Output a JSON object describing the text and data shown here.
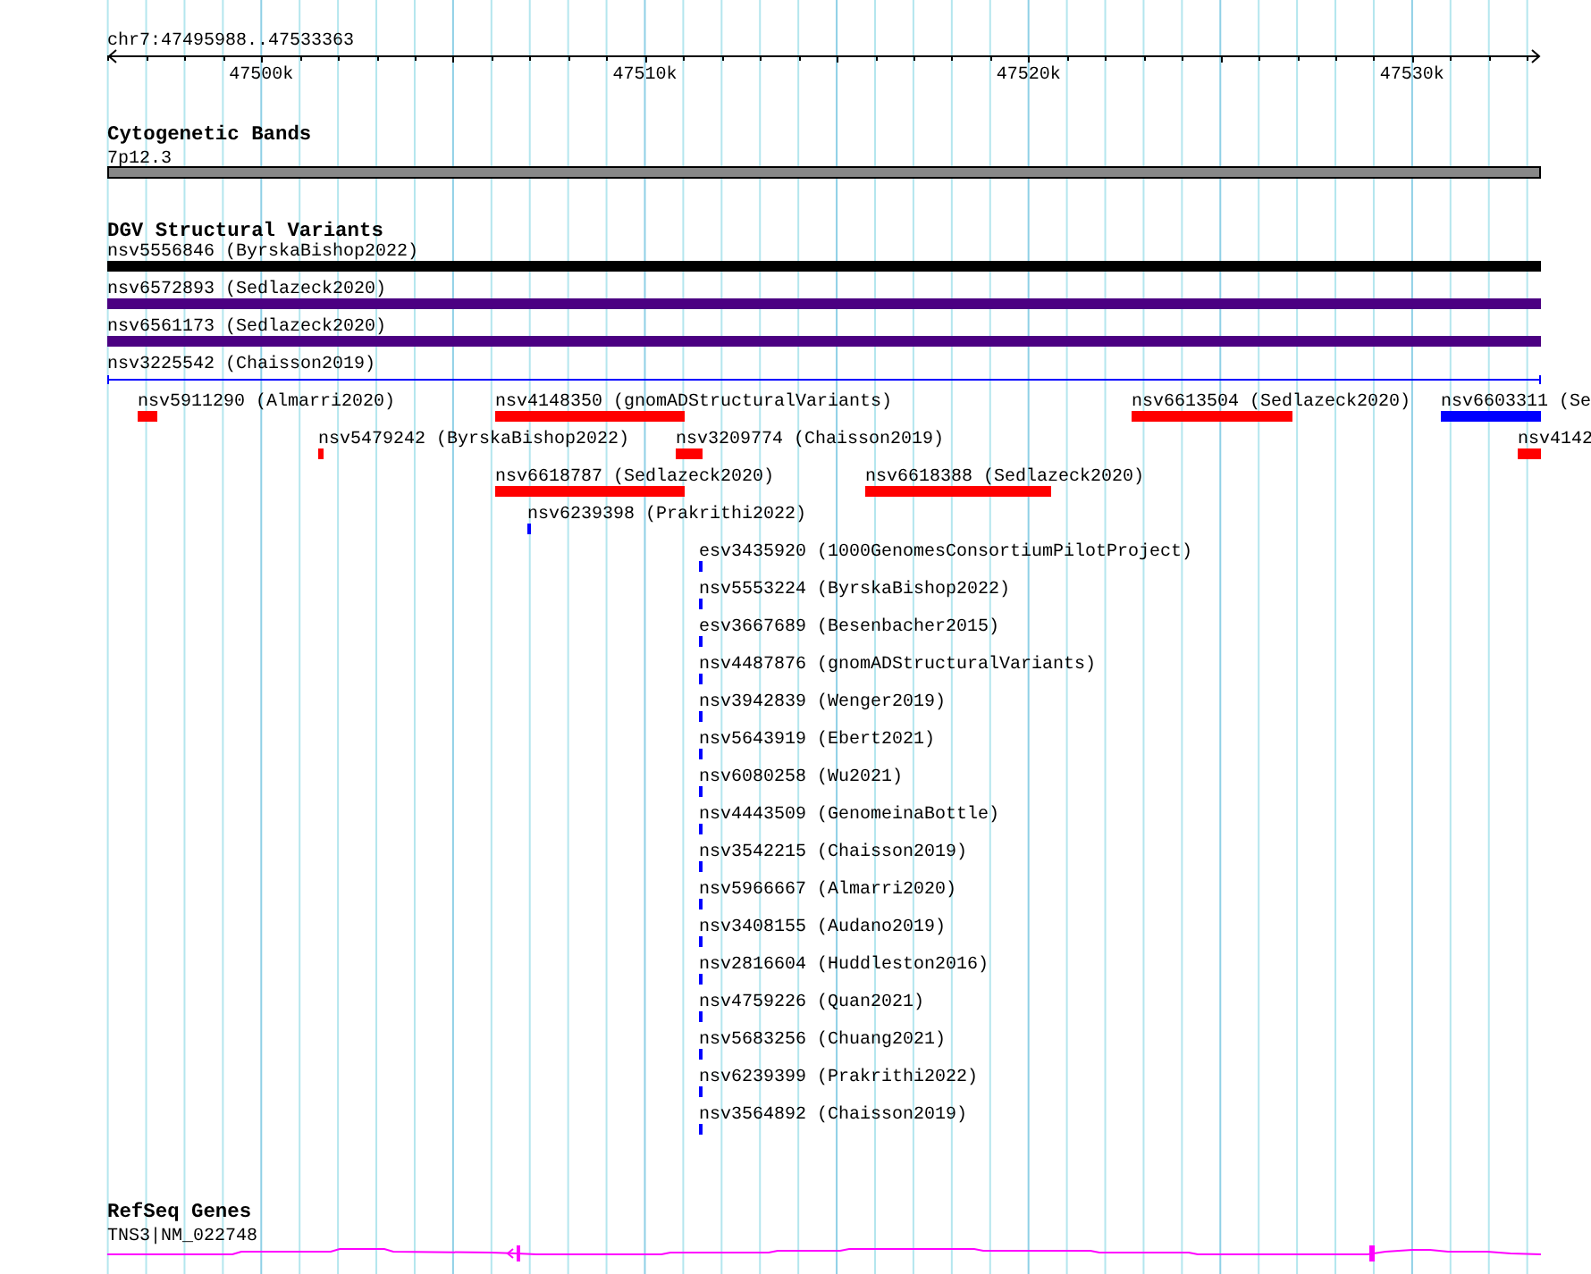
{
  "ruler": {
    "position": "chr7:47495988..47533363",
    "ticks": [
      "47500k",
      "47510k",
      "47520k",
      "47530k"
    ]
  },
  "tracks": [
    {
      "kind": "cytoband",
      "title": "Cytogenetic Bands",
      "features": [
        {
          "label": "7p12.3"
        }
      ]
    },
    {
      "kind": "dgv",
      "title": "DGV Structural Variants",
      "features": [
        {
          "label": "nsv5556846 (ByrskaBishop2022)",
          "kind": "bar",
          "color": "#000000"
        },
        {
          "label": "nsv6572893 (Sedlazeck2020)",
          "kind": "bar",
          "color": "#4b0082"
        },
        {
          "label": "nsv6561173 (Sedlazeck2020)",
          "kind": "bar",
          "color": "#4b0082"
        },
        {
          "label": "nsv3225542 (Chaisson2019)",
          "kind": "span",
          "color": "#0000ff"
        },
        {
          "label": "nsv5911290 (Almarri2020)",
          "kind": "bar",
          "color": "#ff0000"
        },
        {
          "label": "nsv4148350 (gnomADStructuralVariants)",
          "kind": "bar",
          "color": "#ff0000"
        },
        {
          "label": "nsv6613504 (Sedlazeck2020)",
          "kind": "bar",
          "color": "#ff0000"
        },
        {
          "label": "nsv6603311 (Se",
          "kind": "bar",
          "color": "#0000ff"
        },
        {
          "label": "nsv5479242 (ByrskaBishop2022)",
          "kind": "bar",
          "color": "#ff0000"
        },
        {
          "label": "nsv3209774 (Chaisson2019)",
          "kind": "bar",
          "color": "#ff0000"
        },
        {
          "label": "nsv4142",
          "kind": "bar",
          "color": "#ff0000"
        },
        {
          "label": "nsv6618787 (Sedlazeck2020)",
          "kind": "bar",
          "color": "#ff0000"
        },
        {
          "label": "nsv6618388 (Sedlazeck2020)",
          "kind": "bar",
          "color": "#ff0000"
        },
        {
          "label": "nsv6239398 (Prakrithi2022)",
          "kind": "bar",
          "color": "#0000ff"
        },
        {
          "label": "esv3435920 (1000GenomesConsortiumPilotProject)",
          "kind": "bar",
          "color": "#0000ff"
        },
        {
          "label": "nsv5553224 (ByrskaBishop2022)",
          "kind": "bar",
          "color": "#0000ff"
        },
        {
          "label": "esv3667689 (Besenbacher2015)",
          "kind": "bar",
          "color": "#0000ff"
        },
        {
          "label": "nsv4487876 (gnomADStructuralVariants)",
          "kind": "bar",
          "color": "#0000ff"
        },
        {
          "label": "nsv3942839 (Wenger2019)",
          "kind": "bar",
          "color": "#0000ff"
        },
        {
          "label": "nsv5643919 (Ebert2021)",
          "kind": "bar",
          "color": "#0000ff"
        },
        {
          "label": "nsv6080258 (Wu2021)",
          "kind": "bar",
          "color": "#0000ff"
        },
        {
          "label": "nsv4443509 (GenomeinaBottle)",
          "kind": "bar",
          "color": "#0000ff"
        },
        {
          "label": "nsv3542215 (Chaisson2019)",
          "kind": "bar",
          "color": "#0000ff"
        },
        {
          "label": "nsv5966667 (Almarri2020)",
          "kind": "bar",
          "color": "#0000ff"
        },
        {
          "label": "nsv3408155 (Audano2019)",
          "kind": "bar",
          "color": "#0000ff"
        },
        {
          "label": "nsv2816604 (Huddleston2016)",
          "kind": "bar",
          "color": "#0000ff"
        },
        {
          "label": "nsv4759226 (Quan2021)",
          "kind": "bar",
          "color": "#0000ff"
        },
        {
          "label": "nsv5683256 (Chuang2021)",
          "kind": "bar",
          "color": "#0000ff"
        },
        {
          "label": "nsv6239399 (Prakrithi2022)",
          "kind": "bar",
          "color": "#0000ff"
        },
        {
          "label": "nsv3564892 (Chaisson2019)",
          "kind": "bar",
          "color": "#0000ff"
        }
      ]
    },
    {
      "kind": "gene",
      "title": "RefSeq Genes",
      "features": [
        {
          "label": "TNS3|NM_022748"
        }
      ]
    }
  ]
}
